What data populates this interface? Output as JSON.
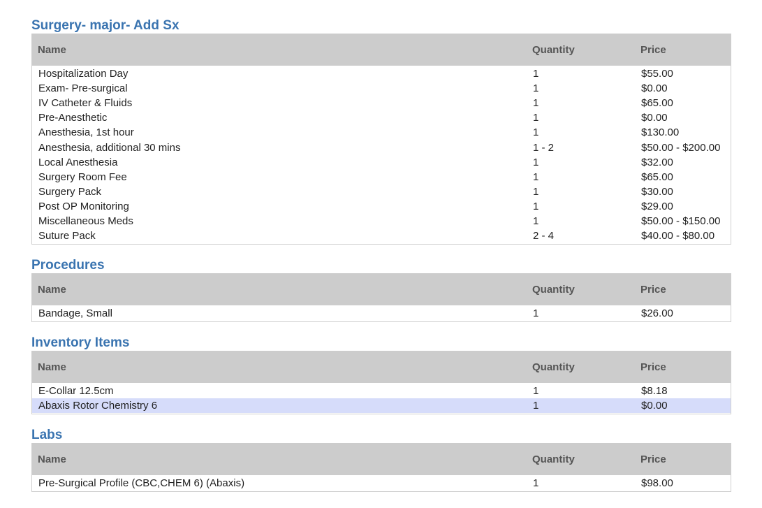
{
  "headers": {
    "name": "Name",
    "quantity": "Quantity",
    "price": "Price"
  },
  "sections": [
    {
      "title": "Surgery- major- Add Sx",
      "rows": [
        {
          "name": "Hospitalization Day",
          "quantity": "1",
          "price": "$55.00"
        },
        {
          "name": "Exam- Pre-surgical",
          "quantity": "1",
          "price": "$0.00"
        },
        {
          "name": "IV Catheter & Fluids",
          "quantity": "1",
          "price": "$65.00"
        },
        {
          "name": "Pre-Anesthetic",
          "quantity": "1",
          "price": "$0.00"
        },
        {
          "name": "Anesthesia, 1st hour",
          "quantity": "1",
          "price": "$130.00"
        },
        {
          "name": "Anesthesia, additional 30 mins",
          "quantity": "1 - 2",
          "price": "$50.00 - $200.00"
        },
        {
          "name": "Local Anesthesia",
          "quantity": "1",
          "price": "$32.00"
        },
        {
          "name": "Surgery Room Fee",
          "quantity": "1",
          "price": "$65.00"
        },
        {
          "name": "Surgery Pack",
          "quantity": "1",
          "price": "$30.00"
        },
        {
          "name": "Post OP Monitoring",
          "quantity": "1",
          "price": "$29.00"
        },
        {
          "name": "Miscellaneous Meds",
          "quantity": "1",
          "price": "$50.00 - $150.00"
        },
        {
          "name": "Suture Pack",
          "quantity": "2 - 4",
          "price": "$40.00 - $80.00"
        }
      ]
    },
    {
      "title": "Procedures",
      "rows": [
        {
          "name": "Bandage, Small",
          "quantity": "1",
          "price": "$26.00"
        }
      ]
    },
    {
      "title": "Inventory Items",
      "rows": [
        {
          "name": "E-Collar 12.5cm",
          "quantity": "1",
          "price": "$8.18"
        },
        {
          "name": "Abaxis Rotor Chemistry 6",
          "quantity": "1",
          "price": "$0.00",
          "highlighted": true
        }
      ]
    },
    {
      "title": "Labs",
      "rows": [
        {
          "name": "Pre-Surgical Profile (CBC,CHEM 6) (Abaxis)",
          "quantity": "1",
          "price": "$98.00"
        }
      ]
    }
  ]
}
